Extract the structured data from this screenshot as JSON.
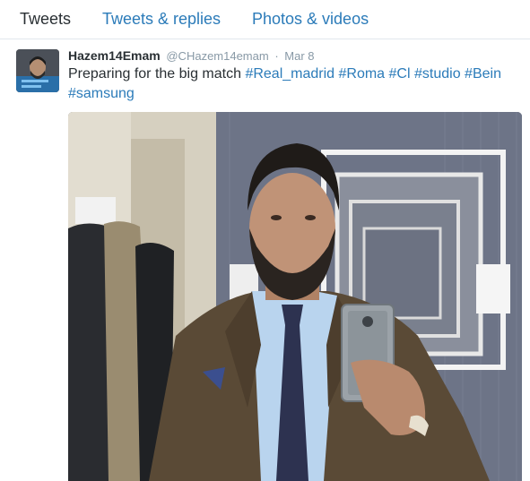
{
  "tabs": {
    "tweets": "Tweets",
    "replies": "Tweets & replies",
    "media": "Photos & videos"
  },
  "tweet": {
    "fullname": "Hazem14Emam",
    "handle": "@CHazem14emam",
    "separator": "·",
    "time": "Mar 8",
    "text_plain": "Preparing for the big match ",
    "hashtags": [
      "#Real_madrid",
      "#Roma",
      "#Cl",
      "#studio",
      "#Bein",
      "#samsung"
    ]
  },
  "colors": {
    "link": "#2b7bb9",
    "text": "#292f33",
    "muted": "#8899a6"
  },
  "icons": {
    "avatar": "user-avatar",
    "photo": "selfie-photo"
  }
}
